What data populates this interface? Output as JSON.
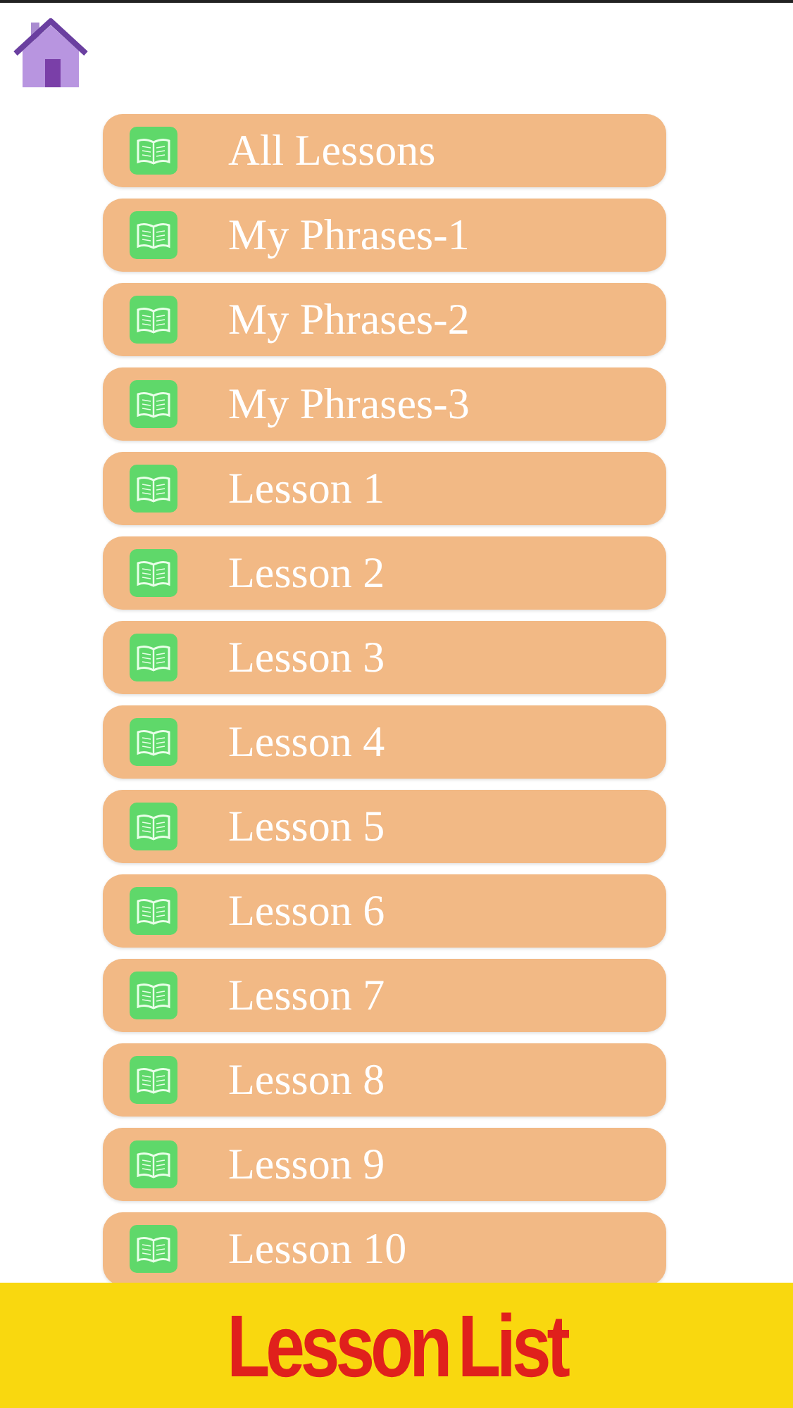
{
  "lessons": [
    {
      "label": "All Lessons"
    },
    {
      "label": "My Phrases-1"
    },
    {
      "label": "My Phrases-2"
    },
    {
      "label": "My Phrases-3"
    },
    {
      "label": "Lesson 1"
    },
    {
      "label": "Lesson 2"
    },
    {
      "label": "Lesson 3"
    },
    {
      "label": "Lesson 4"
    },
    {
      "label": "Lesson 5"
    },
    {
      "label": "Lesson 6"
    },
    {
      "label": "Lesson 7"
    },
    {
      "label": "Lesson 8"
    },
    {
      "label": "Lesson 9"
    },
    {
      "label": "Lesson 10"
    }
  ],
  "footer": {
    "title": "Lesson List"
  }
}
